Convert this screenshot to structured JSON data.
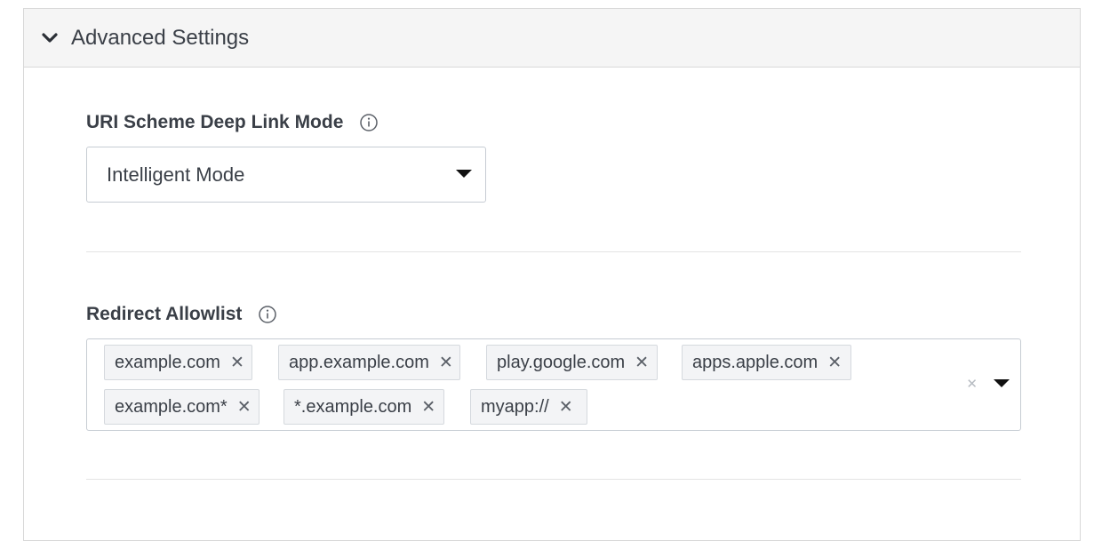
{
  "section": {
    "title": "Advanced Settings",
    "expanded": true
  },
  "deep_link": {
    "label": "URI Scheme Deep Link Mode",
    "selected": "Intelligent Mode"
  },
  "allowlist": {
    "label": "Redirect Allowlist",
    "tags": [
      "example.com",
      "app.example.com",
      "play.google.com",
      "apps.apple.com",
      "example.com*",
      "*.example.com",
      "myapp://"
    ],
    "remove_glyph": "✕",
    "clear_glyph": "✕"
  },
  "icons": {
    "collapse": "chevron-down-icon",
    "info": "info-icon",
    "dropdown": "caret-down-icon"
  },
  "colors": {
    "header_bg": "#f5f5f5",
    "border": "#c6ccd3",
    "tag_bg": "#f3f4f6",
    "text": "#3a3f47"
  }
}
